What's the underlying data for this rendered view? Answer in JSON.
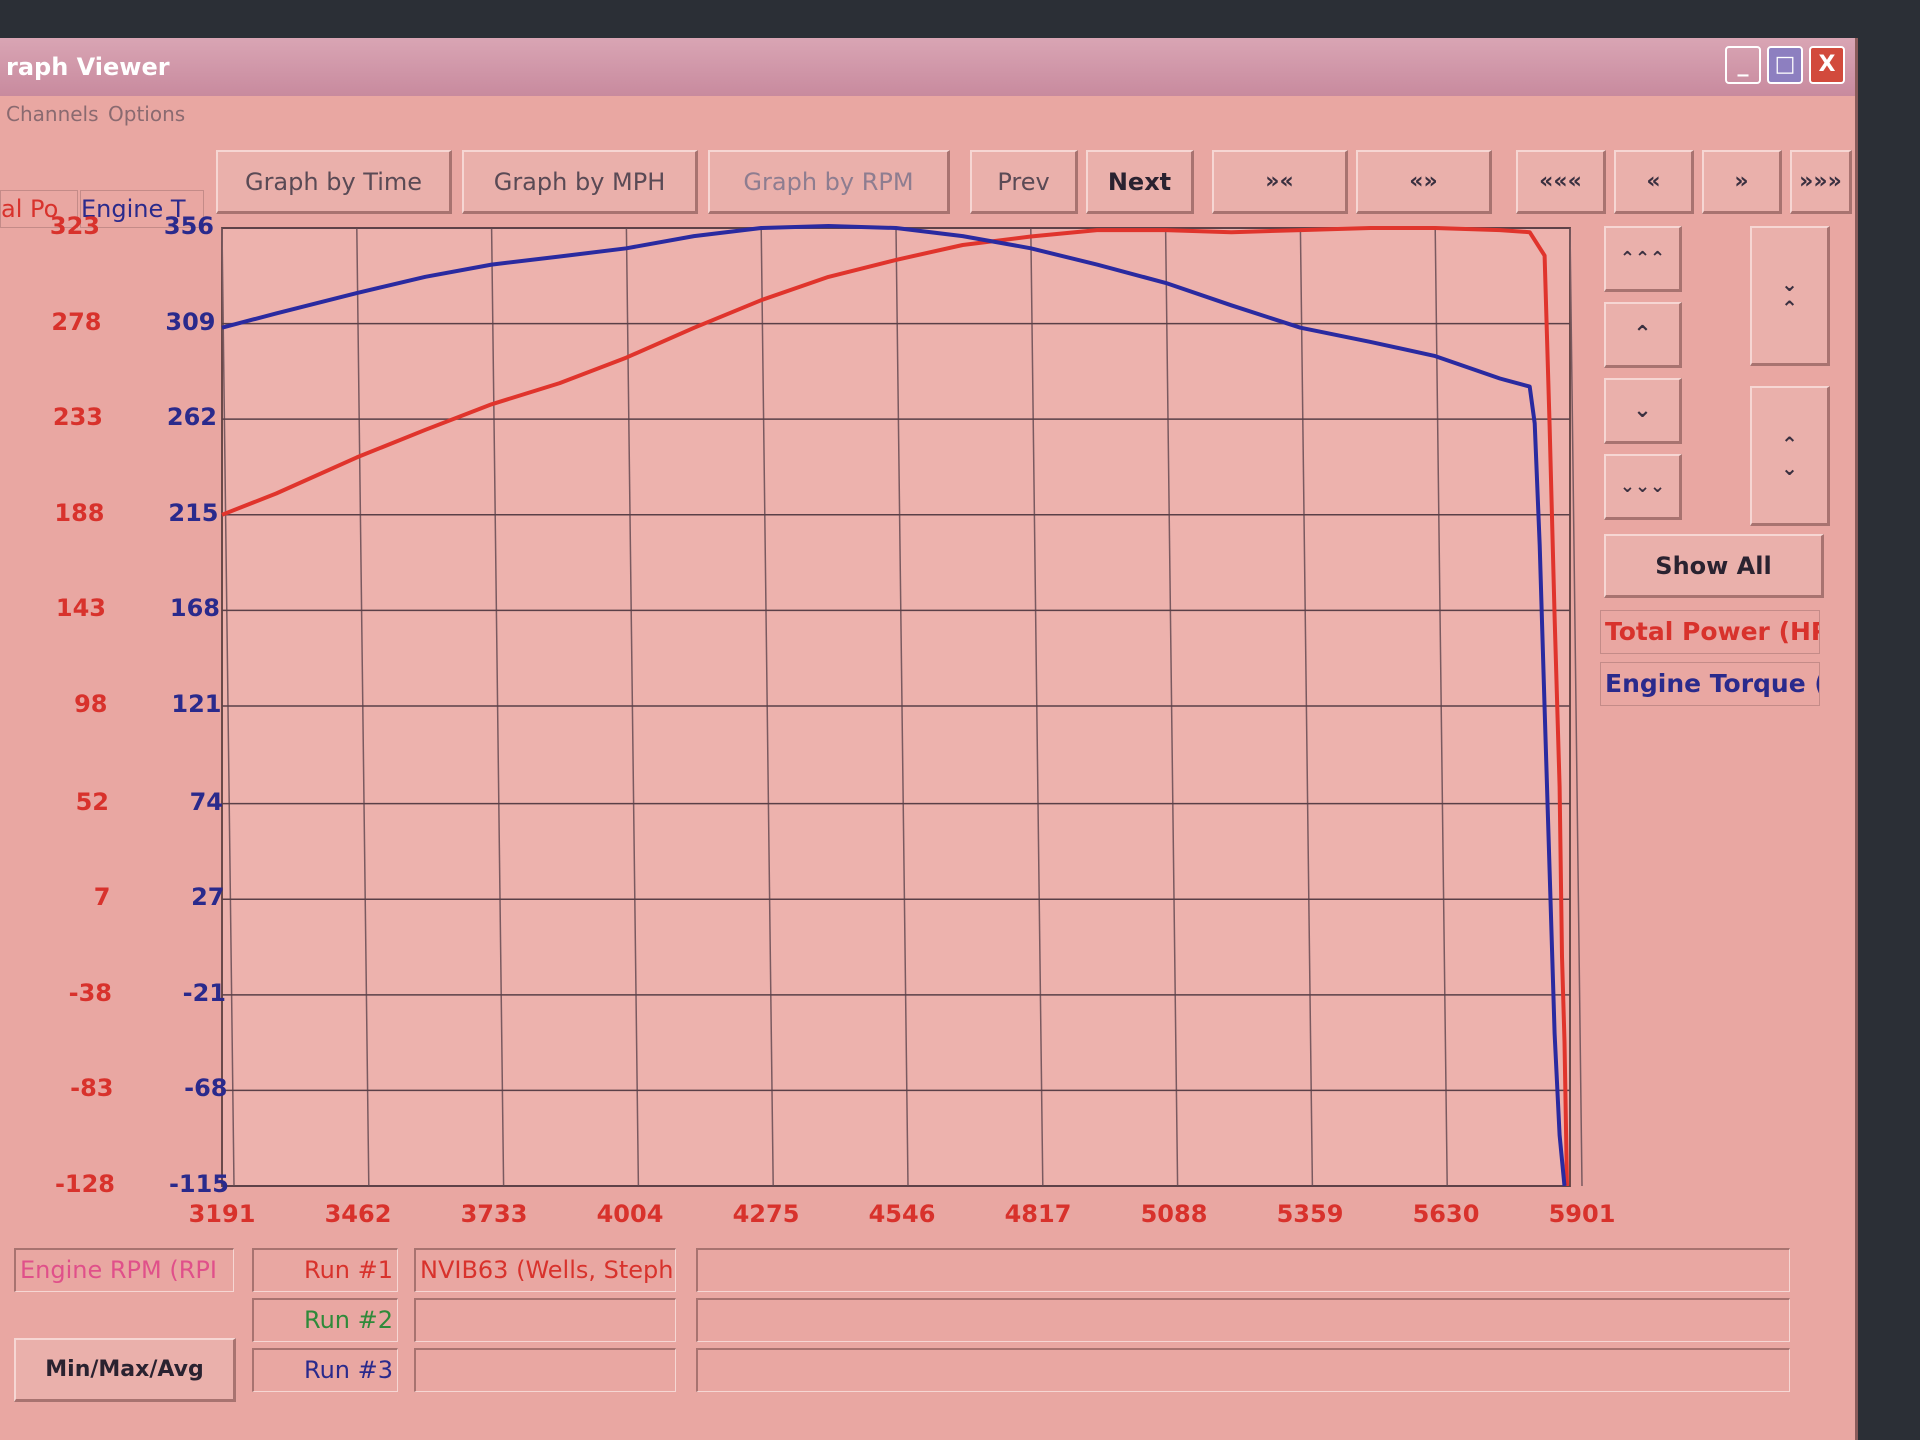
{
  "window": {
    "title": "raph Viewer",
    "controls": [
      "_",
      "□",
      "X"
    ]
  },
  "menu": [
    "Channels",
    "Options"
  ],
  "tabs": [
    {
      "label": "al Po",
      "color": "#d8322c"
    },
    {
      "label": "Engine T",
      "color": "#2a2a8c"
    }
  ],
  "toolbar": {
    "graph_by_time": "Graph by Time",
    "graph_by_mph": "Graph by MPH",
    "graph_by_rpm": "Graph by RPM",
    "prev": "Prev",
    "next": "Next",
    "zoom_in_x": "»«",
    "zoom_out_x": "«»",
    "first": "«««",
    "back": "«",
    "forward": "»",
    "last": "»»»"
  },
  "side_controls": {
    "show_all": "Show All",
    "up_fast": "⌃⌃⌃",
    "up": "⌃",
    "down": "⌄",
    "down_fast": "⌄⌄⌄",
    "zoom_y_in": "⌄⌃",
    "zoom_y_out": "⌃⌄"
  },
  "legend": [
    {
      "label": "Total Power (HP",
      "color": "#d8322c"
    },
    {
      "label": "Engine Torque (l",
      "color": "#2a2a8c"
    }
  ],
  "bottom": {
    "x_channel": "Engine RPM (RPI",
    "min_max_avg": "Min/Max/Avg",
    "runs": [
      {
        "label": "Run #1",
        "name": "NVIB63 (Wells, Steph",
        "color": "#d8322c"
      },
      {
        "label": "Run #2",
        "name": "",
        "color": "#2f8a3a"
      },
      {
        "label": "Run #3",
        "name": "",
        "color": "#2a2a8c"
      }
    ]
  },
  "chart_data": {
    "type": "line",
    "xlabel": "",
    "x_ticks": [
      3191,
      3462,
      3733,
      4004,
      4275,
      4546,
      4817,
      5088,
      5359,
      5630,
      5901
    ],
    "y_ticks_left": [
      323,
      278,
      233,
      188,
      143,
      98,
      52,
      7,
      -38,
      -83,
      -128
    ],
    "y_ticks_right": [
      356,
      309,
      262,
      215,
      168,
      121,
      74,
      27,
      -21,
      -68,
      -115
    ],
    "xlim": [
      3191,
      5901
    ],
    "ylim_left": [
      -128,
      323
    ],
    "ylim_right": [
      -115,
      356
    ],
    "grid": true,
    "series": [
      {
        "name": "Total Power (HP",
        "axis": "left",
        "color": "#e0342c",
        "points": [
          [
            3191,
            188
          ],
          [
            3300,
            198
          ],
          [
            3462,
            215
          ],
          [
            3600,
            228
          ],
          [
            3733,
            240
          ],
          [
            3870,
            250
          ],
          [
            4004,
            262
          ],
          [
            4140,
            276
          ],
          [
            4275,
            289
          ],
          [
            4410,
            300
          ],
          [
            4546,
            308
          ],
          [
            4680,
            315
          ],
          [
            4817,
            319
          ],
          [
            4950,
            322
          ],
          [
            5088,
            322
          ],
          [
            5220,
            321
          ],
          [
            5359,
            322
          ],
          [
            5500,
            323
          ],
          [
            5630,
            323
          ],
          [
            5760,
            322
          ],
          [
            5820,
            321
          ],
          [
            5850,
            310
          ],
          [
            5860,
            230
          ],
          [
            5870,
            140
          ],
          [
            5880,
            60
          ],
          [
            5885,
            -20
          ],
          [
            5890,
            -60
          ],
          [
            5895,
            -128
          ]
        ]
      },
      {
        "name": "Engine Torque (l",
        "axis": "right",
        "color": "#2a2aa0",
        "points": [
          [
            3191,
            307
          ],
          [
            3300,
            314
          ],
          [
            3462,
            324
          ],
          [
            3600,
            332
          ],
          [
            3733,
            338
          ],
          [
            3870,
            342
          ],
          [
            4004,
            346
          ],
          [
            4140,
            352
          ],
          [
            4275,
            356
          ],
          [
            4410,
            357
          ],
          [
            4546,
            356
          ],
          [
            4680,
            352
          ],
          [
            4817,
            346
          ],
          [
            4950,
            338
          ],
          [
            5088,
            329
          ],
          [
            5220,
            318
          ],
          [
            5359,
            307
          ],
          [
            5500,
            300
          ],
          [
            5630,
            293
          ],
          [
            5760,
            282
          ],
          [
            5820,
            278
          ],
          [
            5830,
            260
          ],
          [
            5840,
            200
          ],
          [
            5850,
            120
          ],
          [
            5860,
            40
          ],
          [
            5870,
            -40
          ],
          [
            5880,
            -90
          ],
          [
            5890,
            -115
          ]
        ]
      }
    ]
  }
}
